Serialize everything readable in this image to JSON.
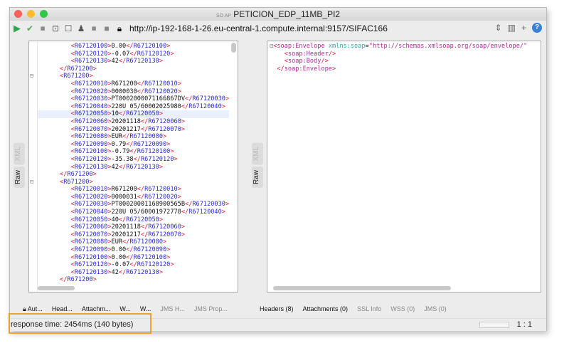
{
  "window": {
    "title": "PETICION_EDP_11MB_PI2",
    "soap_badge": "SO AP"
  },
  "toolbar": {
    "url": "http://ip-192-168-1-26.eu-central-1.compute.internal:9157/SIFAC166",
    "icons": [
      "run-icon",
      "validate-icon",
      "soap-icon",
      "format-icon",
      "checkbox-icon",
      "stamp-icon",
      "soap-icon",
      "stop-icon",
      "lock-icon"
    ]
  },
  "request": {
    "side_tabs": [
      "XML",
      "Raw"
    ],
    "lines": [
      {
        "i": 2,
        "tag": "R67120100",
        "val": "0.00"
      },
      {
        "i": 2,
        "tag": "R67120120",
        "val": "-0.07"
      },
      {
        "i": 2,
        "tag": "R67120130",
        "val": "42"
      },
      {
        "i": 1,
        "close": "R671200"
      },
      {
        "i": 1,
        "open": "R671200",
        "fold": true
      },
      {
        "i": 2,
        "tag": "R67120010",
        "val": "R671200"
      },
      {
        "i": 2,
        "tag": "R67120020",
        "val": "0000030"
      },
      {
        "i": 2,
        "tag": "R67120030",
        "val": "PT0002000071166867DV"
      },
      {
        "i": 2,
        "tag": "R67120040",
        "val": "220U 05/60002025980"
      },
      {
        "i": 2,
        "tag": "R67120050",
        "val": "10",
        "hl": true
      },
      {
        "i": 2,
        "tag": "R67120060",
        "val": "20201118"
      },
      {
        "i": 2,
        "tag": "R67120070",
        "val": "20201217"
      },
      {
        "i": 2,
        "tag": "R67120080",
        "val": "EUR"
      },
      {
        "i": 2,
        "tag": "R67120090",
        "val": "0.79"
      },
      {
        "i": 2,
        "tag": "R67120100",
        "val": "-0.79"
      },
      {
        "i": 2,
        "tag": "R67120120",
        "val": "-35.38"
      },
      {
        "i": 2,
        "tag": "R67120130",
        "val": "42"
      },
      {
        "i": 1,
        "close": "R671200"
      },
      {
        "i": 1,
        "open": "R671200",
        "fold": true
      },
      {
        "i": 2,
        "tag": "R67120010",
        "val": "R671200"
      },
      {
        "i": 2,
        "tag": "R67120020",
        "val": "0000031"
      },
      {
        "i": 2,
        "tag": "R67120030",
        "val": "PT00020001168900565B"
      },
      {
        "i": 2,
        "tag": "R67120040",
        "val": "220U 05/60001972778"
      },
      {
        "i": 2,
        "tag": "R67120050",
        "val": "40"
      },
      {
        "i": 2,
        "tag": "R67120060",
        "val": "20201118"
      },
      {
        "i": 2,
        "tag": "R67120070",
        "val": "20201217"
      },
      {
        "i": 2,
        "tag": "R67120080",
        "val": "EUR"
      },
      {
        "i": 2,
        "tag": "R67120090",
        "val": "0.00"
      },
      {
        "i": 2,
        "tag": "R67120100",
        "val": "0.00"
      },
      {
        "i": 2,
        "tag": "R67120120",
        "val": "-0.07"
      },
      {
        "i": 2,
        "tag": "R67120130",
        "val": "42"
      },
      {
        "i": 1,
        "close": "R671200"
      }
    ],
    "tabs": [
      {
        "label": "Aut...",
        "lock": true
      },
      {
        "label": "Head..."
      },
      {
        "label": "Attachm..."
      },
      {
        "label": "W..."
      },
      {
        "label": "W..."
      },
      {
        "label": "JMS H...",
        "dim": true
      },
      {
        "label": "JMS Prop...",
        "dim": true
      }
    ]
  },
  "response": {
    "side_tabs": [
      "XML",
      "Raw"
    ],
    "envelope_open": "soap:Envelope",
    "xmlns_attr": "xmlns:soap",
    "xmlns_value": "\"http://schemas.xmlsoap.org/soap/envelope/\"",
    "header": "soap:Header",
    "body": "soap:Body",
    "tabs": [
      {
        "label": "Headers (8)"
      },
      {
        "label": "Attachments (0)"
      },
      {
        "label": "SSL Info",
        "dim": true
      },
      {
        "label": "WSS (0)",
        "dim": true
      },
      {
        "label": "JMS (0)",
        "dim": true
      }
    ]
  },
  "status": {
    "response_time": "response time: 2454ms (140 bytes)",
    "position": "1 : 1"
  },
  "colors": {
    "highlight_box": "#f0a030",
    "tag": "#2a2ad0",
    "bracket": "#d2203a"
  }
}
